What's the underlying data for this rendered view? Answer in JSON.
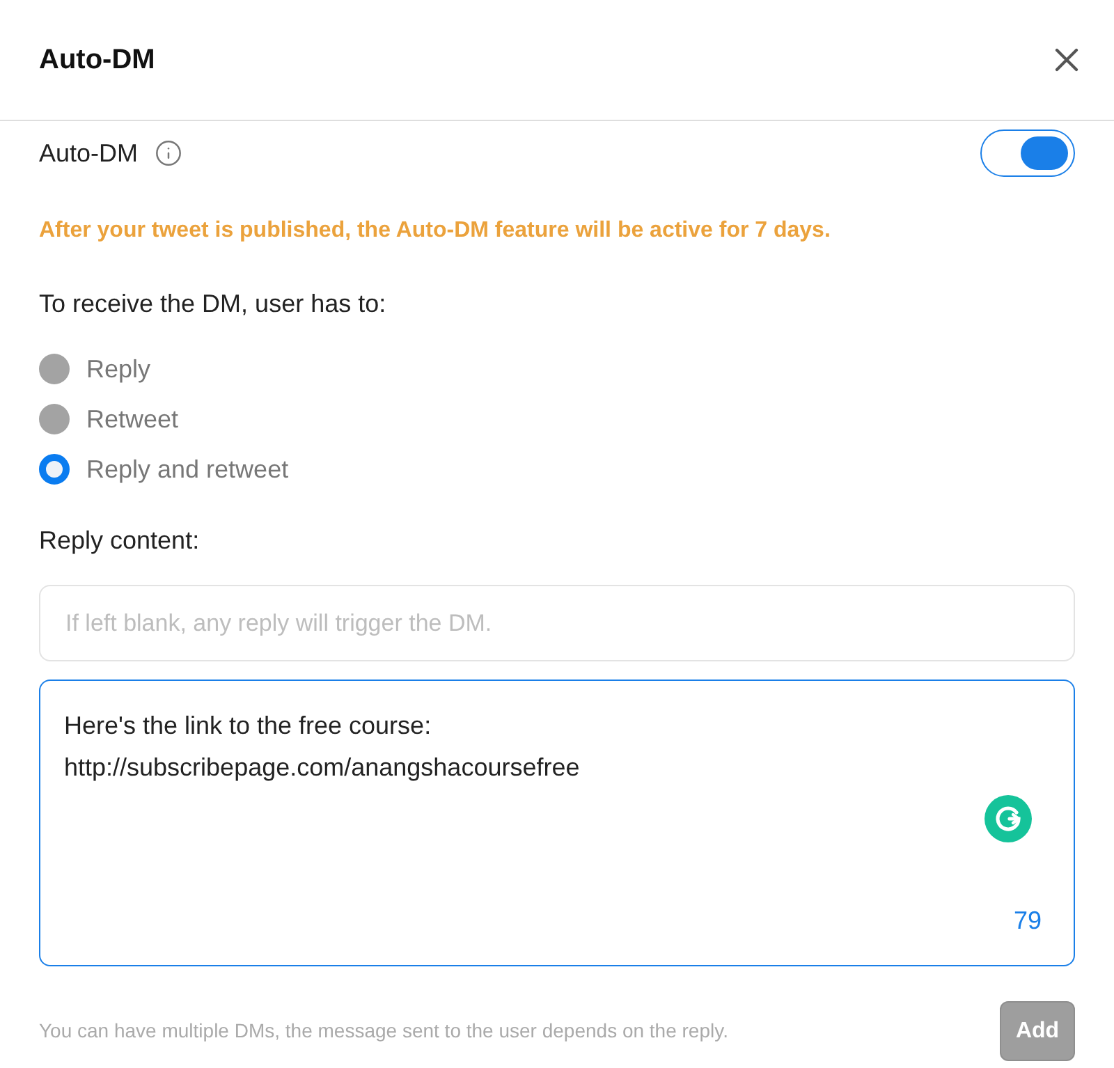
{
  "dialog": {
    "title": "Auto-DM"
  },
  "auto_dm": {
    "label": "Auto-DM",
    "on": true
  },
  "notice": "After your tweet is published, the Auto-DM feature will be active for 7 days.",
  "condition": {
    "label": "To receive the DM, user has to:",
    "options": [
      {
        "label": "Reply",
        "selected": false
      },
      {
        "label": "Retweet",
        "selected": false
      },
      {
        "label": "Reply and retweet",
        "selected": true
      }
    ]
  },
  "reply_content": {
    "label": "Reply content:",
    "trigger_field": {
      "placeholder": "If left blank, any reply will trigger the DM."
    },
    "message_field": {
      "value": "Here's the link to the free course:\nhttp://subscribepage.com/anangshacoursefree",
      "counter": "79"
    }
  },
  "footer": {
    "hint": "You can have multiple DMs, the message sent to the user depends on the reply.",
    "add_button": {
      "label": "Add",
      "disabled": true
    }
  }
}
